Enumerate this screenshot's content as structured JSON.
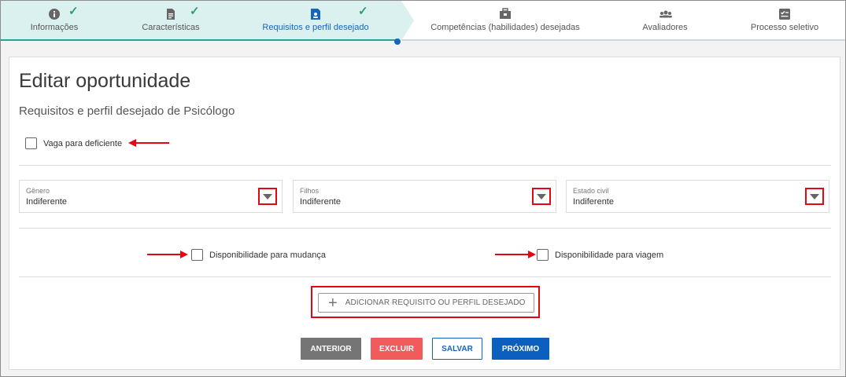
{
  "stepper": {
    "steps": [
      {
        "label": "Informações",
        "icon": "info-icon",
        "done": true
      },
      {
        "label": "Características",
        "icon": "document-icon",
        "done": true
      },
      {
        "label": "Requisitos e perfil desejado",
        "icon": "badge-icon",
        "done": true
      },
      {
        "label": "Competências (habilidades) desejadas",
        "icon": "briefcase-icon",
        "done": false
      },
      {
        "label": "Avaliadores",
        "icon": "group-icon",
        "done": false
      },
      {
        "label": "Processo seletivo",
        "icon": "checklist-icon",
        "done": false
      }
    ],
    "check_glyph": "✓"
  },
  "page": {
    "title": "Editar oportunidade",
    "subtitle": "Requisitos e perfil desejado de Psicólogo"
  },
  "form": {
    "deficiente_label": "Vaga para deficiente",
    "selects": [
      {
        "label": "Gênero",
        "value": "Indiferente"
      },
      {
        "label": "Filhos",
        "value": "Indiferente"
      },
      {
        "label": "Estado civil",
        "value": "Indiferente"
      }
    ],
    "mudanca_label": "Disponibilidade para mudança",
    "viagem_label": "Disponibilidade para viagem",
    "add_label": "ADICIONAR REQUISITO OU PERFIL DESEJADO",
    "add_plus": "+"
  },
  "actions": {
    "anterior": "ANTERIOR",
    "excluir": "EXCLUIR",
    "salvar": "SALVAR",
    "proximo": "PRÓXIMO"
  },
  "colors": {
    "stepper_done_bg": "#dbf1ef",
    "active_blue": "#1565c0",
    "check_green": "#2e9e6b",
    "annotation_red": "#e30613",
    "btn_anterior": "#757575",
    "btn_excluir": "#f15b5b",
    "btn_proximo": "#0d5fbf"
  }
}
